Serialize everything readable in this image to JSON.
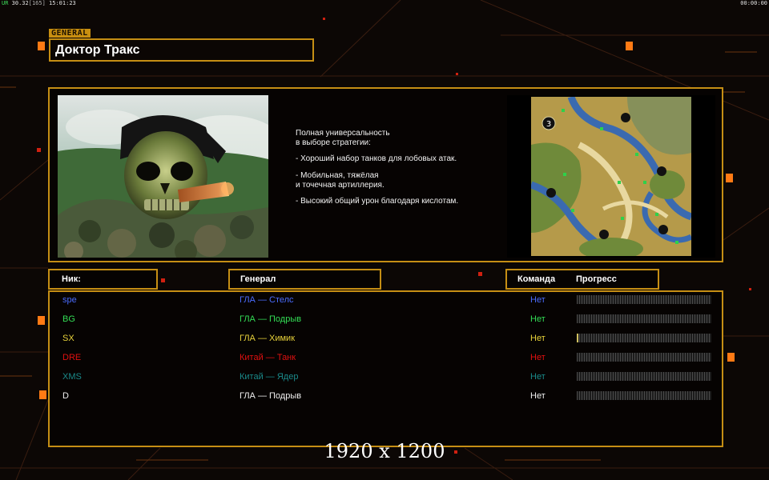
{
  "hud": {
    "fps_label": "UR",
    "fps": "30.32",
    "latency": "[165]",
    "clock": "15:01:23",
    "timer": "00:00:00"
  },
  "general_tag": "GENERAL",
  "general_name": "Доктор Тракс",
  "portrait_icon": "skull-soldier-portrait",
  "description": [
    "Полная универсальность\nв выборе стратегии:",
    "- Хороший набор танков для лобовых атак.",
    "- Мобильная, тяжёлая\nи точечная артиллерия.",
    "- Высокий общий урон благодаря кислотам."
  ],
  "minimap": {
    "icon": "map-preview",
    "start_position_label": "3"
  },
  "headers": {
    "nick": "Ник:",
    "general": "Генерал",
    "team": "Команда",
    "progress": "Прогресс"
  },
  "players": [
    {
      "nick": "spe",
      "general": "ГЛА — Стелс",
      "team": "Нет",
      "color": "#4a6cff",
      "progress": 0
    },
    {
      "nick": "BG",
      "general": "ГЛА — Подрыв",
      "team": "Нет",
      "color": "#33dd55",
      "progress": 0
    },
    {
      "nick": "SX",
      "general": "ГЛА — Химик",
      "team": "Нет",
      "color": "#e8d23a",
      "progress": 0.01
    },
    {
      "nick": "DRE",
      "general": "Китай — Танк",
      "team": "Нет",
      "color": "#e01010",
      "progress": 0
    },
    {
      "nick": "XMS",
      "general": "Китай — Ядер",
      "team": "Нет",
      "color": "#1a8a8a",
      "progress": 0
    },
    {
      "nick": "D",
      "general": "ГЛА — Подрыв",
      "team": "Нет",
      "color": "#f0f0f0",
      "progress": 0
    }
  ],
  "resolution_label": "1920 x 1200",
  "accent_color": "#c58e14"
}
